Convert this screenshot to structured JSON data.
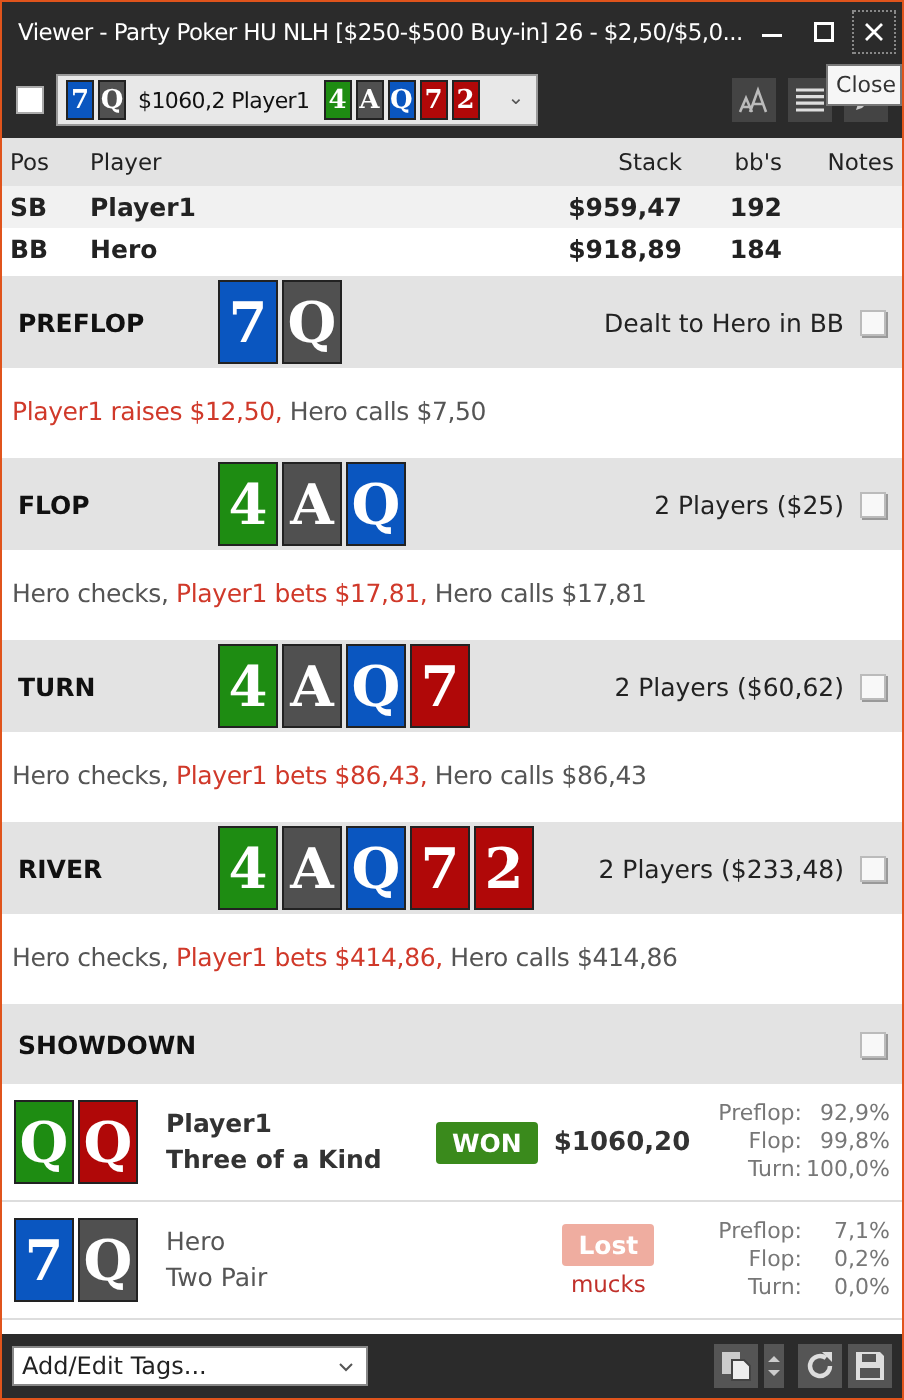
{
  "window": {
    "title": "Viewer - Party Poker HU NLH [$250-$500 Buy-in] 26 - $2,50/$5,0...",
    "tooltip": "Close"
  },
  "toolbar": {
    "select_all_checked": false,
    "hand": {
      "hole_cards": [
        {
          "rank": "7",
          "color": "#0a56c0"
        },
        {
          "rank": "Q",
          "color": "#505050"
        }
      ],
      "label": "$1060,2 Player1",
      "board": [
        {
          "rank": "4",
          "color": "#1e8c12"
        },
        {
          "rank": "A",
          "color": "#505050"
        },
        {
          "rank": "Q",
          "color": "#0a56c0"
        },
        {
          "rank": "7",
          "color": "#b00808"
        },
        {
          "rank": "2",
          "color": "#b00808"
        }
      ],
      "caret": "⌄"
    }
  },
  "players_table": {
    "columns": [
      "Pos",
      "Player",
      "Stack",
      "bb's",
      "Notes"
    ],
    "rows": [
      {
        "pos": "SB",
        "player": "Player1",
        "stack": "$959,47",
        "bbs": "192"
      },
      {
        "pos": "BB",
        "player": "Hero",
        "stack": "$918,89",
        "bbs": "184"
      }
    ]
  },
  "streets": [
    {
      "name": "PREFLOP",
      "cards": [
        {
          "rank": "7",
          "color": "#0a56c0"
        },
        {
          "rank": "Q",
          "color": "#505050"
        }
      ],
      "info": "Dealt to Hero in BB",
      "checked": false,
      "actions": [
        {
          "text": "Player1 raises $12,50,",
          "highlight": true
        },
        {
          "text": "Hero calls $7,50",
          "highlight": false
        }
      ]
    },
    {
      "name": "FLOP",
      "cards": [
        {
          "rank": "4",
          "color": "#1e8c12"
        },
        {
          "rank": "A",
          "color": "#505050"
        },
        {
          "rank": "Q",
          "color": "#0a56c0"
        }
      ],
      "info": "2 Players ($25)",
      "checked": false,
      "actions": [
        {
          "text": "Hero checks,",
          "highlight": false
        },
        {
          "text": "Player1 bets $17,81,",
          "highlight": true
        },
        {
          "text": "Hero calls $17,81",
          "highlight": false
        }
      ]
    },
    {
      "name": "TURN",
      "cards": [
        {
          "rank": "4",
          "color": "#1e8c12"
        },
        {
          "rank": "A",
          "color": "#505050"
        },
        {
          "rank": "Q",
          "color": "#0a56c0"
        },
        {
          "rank": "7",
          "color": "#b00808"
        }
      ],
      "info": "2 Players ($60,62)",
      "checked": false,
      "actions": [
        {
          "text": "Hero checks,",
          "highlight": false
        },
        {
          "text": "Player1 bets $86,43,",
          "highlight": true
        },
        {
          "text": "Hero calls $86,43",
          "highlight": false
        }
      ]
    },
    {
      "name": "RIVER",
      "cards": [
        {
          "rank": "4",
          "color": "#1e8c12"
        },
        {
          "rank": "A",
          "color": "#505050"
        },
        {
          "rank": "Q",
          "color": "#0a56c0"
        },
        {
          "rank": "7",
          "color": "#b00808"
        },
        {
          "rank": "2",
          "color": "#b00808"
        }
      ],
      "info": "2 Players ($233,48)",
      "checked": false,
      "actions": [
        {
          "text": "Hero checks,",
          "highlight": false
        },
        {
          "text": "Player1 bets $414,86,",
          "highlight": true
        },
        {
          "text": "Hero calls $414,86",
          "highlight": false
        }
      ]
    }
  ],
  "showdown": {
    "title": "SHOWDOWN",
    "checked": false,
    "results": [
      {
        "kind": "won",
        "cards": [
          {
            "rank": "Q",
            "color": "#1e8c12"
          },
          {
            "rank": "Q",
            "color": "#b00808"
          }
        ],
        "player": "Player1",
        "hand": "Three of a Kind",
        "badge": "WON",
        "amount": "$1060,20",
        "equity": [
          {
            "street": "Preflop:",
            "value": "92,9%"
          },
          {
            "street": "Flop:",
            "value": "99,8%"
          },
          {
            "street": "Turn:",
            "value": "100,0%"
          }
        ]
      },
      {
        "kind": "lost",
        "cards": [
          {
            "rank": "7",
            "color": "#0a56c0"
          },
          {
            "rank": "Q",
            "color": "#505050"
          }
        ],
        "player": "Hero",
        "hand": "Two Pair",
        "badge": "Lost",
        "amount": "mucks",
        "equity": [
          {
            "street": "Preflop:",
            "value": "7,1%"
          },
          {
            "street": "Flop:",
            "value": "0,2%"
          },
          {
            "street": "Turn:",
            "value": "0,0%"
          }
        ]
      }
    ]
  },
  "footer": {
    "tags_placeholder": "Add/Edit Tags..."
  }
}
